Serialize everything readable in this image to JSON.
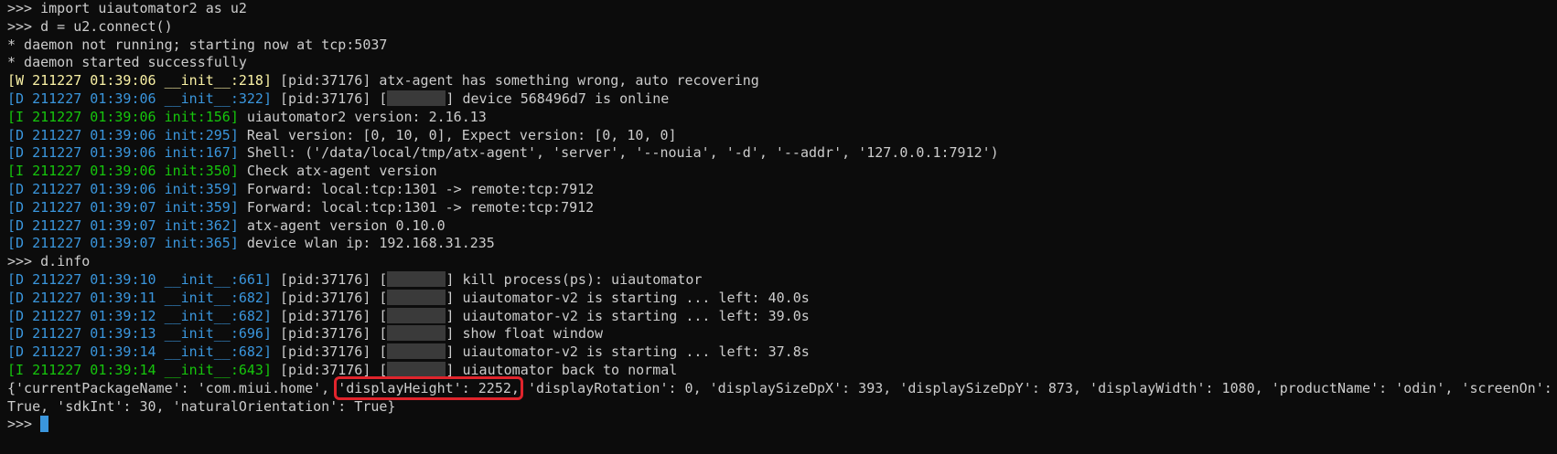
{
  "colors": {
    "background": "#0c0c0c",
    "text": "#cccccc",
    "warn_tag": "#f9f1a5",
    "debug_tag": "#3a96dd",
    "info_tag": "#16c60c",
    "highlight_box": "#e0242c",
    "cursor": "#3a96dd"
  },
  "lines": [
    {
      "kind": "plain",
      "text": ">>> import uiautomator2 as u2"
    },
    {
      "kind": "plain",
      "text": ">>> d = u2.connect()"
    },
    {
      "kind": "plain",
      "text": "* daemon not running; starting now at tcp:5037"
    },
    {
      "kind": "plain",
      "text": "* daemon started successfully"
    },
    {
      "kind": "log",
      "level": "warn",
      "tag": "[W 211227 01:39:06 __init__:218]",
      "pid": " [pid:37176]",
      "redacted": false,
      "msg": " atx-agent has something wrong, auto recovering"
    },
    {
      "kind": "log",
      "level": "debug",
      "tag": "[D 211227 01:39:06 __init__:322]",
      "pid": " [pid:37176]",
      "redacted": true,
      "msg": " device 568496d7 is online"
    },
    {
      "kind": "log",
      "level": "info",
      "tag": "[I 211227 01:39:06 init:156]",
      "pid": "",
      "redacted": false,
      "msg": " uiautomator2 version: 2.16.13"
    },
    {
      "kind": "log",
      "level": "debug",
      "tag": "[D 211227 01:39:06 init:295]",
      "pid": "",
      "redacted": false,
      "msg": " Real version: [0, 10, 0], Expect version: [0, 10, 0]"
    },
    {
      "kind": "log",
      "level": "debug",
      "tag": "[D 211227 01:39:06 init:167]",
      "pid": "",
      "redacted": false,
      "msg": " Shell: ('/data/local/tmp/atx-agent', 'server', '--nouia', '-d', '--addr', '127.0.0.1:7912')"
    },
    {
      "kind": "log",
      "level": "info",
      "tag": "[I 211227 01:39:06 init:350]",
      "pid": "",
      "redacted": false,
      "msg": " Check atx-agent version"
    },
    {
      "kind": "log",
      "level": "debug",
      "tag": "[D 211227 01:39:06 init:359]",
      "pid": "",
      "redacted": false,
      "msg": " Forward: local:tcp:1301 -> remote:tcp:7912"
    },
    {
      "kind": "log",
      "level": "debug",
      "tag": "[D 211227 01:39:07 init:359]",
      "pid": "",
      "redacted": false,
      "msg": " Forward: local:tcp:1301 -> remote:tcp:7912"
    },
    {
      "kind": "log",
      "level": "debug",
      "tag": "[D 211227 01:39:07 init:362]",
      "pid": "",
      "redacted": false,
      "msg": " atx-agent version 0.10.0"
    },
    {
      "kind": "log",
      "level": "debug",
      "tag": "[D 211227 01:39:07 init:365]",
      "pid": "",
      "redacted": false,
      "msg": " device wlan ip: 192.168.31.235"
    },
    {
      "kind": "plain",
      "text": ">>> d.info"
    },
    {
      "kind": "log",
      "level": "debug",
      "tag": "[D 211227 01:39:10 __init__:661]",
      "pid": " [pid:37176]",
      "redacted": true,
      "msg": " kill process(ps): uiautomator"
    },
    {
      "kind": "log",
      "level": "debug",
      "tag": "[D 211227 01:39:11 __init__:682]",
      "pid": " [pid:37176]",
      "redacted": true,
      "msg": " uiautomator-v2 is starting ... left: 40.0s"
    },
    {
      "kind": "log",
      "level": "debug",
      "tag": "[D 211227 01:39:12 __init__:682]",
      "pid": " [pid:37176]",
      "redacted": true,
      "msg": " uiautomator-v2 is starting ... left: 39.0s"
    },
    {
      "kind": "log",
      "level": "debug",
      "tag": "[D 211227 01:39:13 __init__:696]",
      "pid": " [pid:37176]",
      "redacted": true,
      "msg": " show float window"
    },
    {
      "kind": "log",
      "level": "debug",
      "tag": "[D 211227 01:39:14 __init__:682]",
      "pid": " [pid:37176]",
      "redacted": true,
      "msg": " uiautomator-v2 is starting ... left: 37.8s"
    },
    {
      "kind": "log",
      "level": "info",
      "tag": "[I 211227 01:39:14 __init__:643]",
      "pid": " [pid:37176]",
      "redacted": true,
      "msg": " uiautomator back to normal"
    }
  ],
  "result": {
    "before": "{'currentPackageName': 'com.miui.home', ",
    "highlighted": "'displayHeight': 2252,",
    "after": " 'displayRotation': 0, 'displaySizeDpX': 393, 'displaySizeDpY': 873, 'displayWidth': 1080, 'productName': 'odin', 'screenOn':",
    "second_line": "True, 'sdkInt': 30, 'naturalOrientation': True}"
  },
  "prompt": ">>> "
}
